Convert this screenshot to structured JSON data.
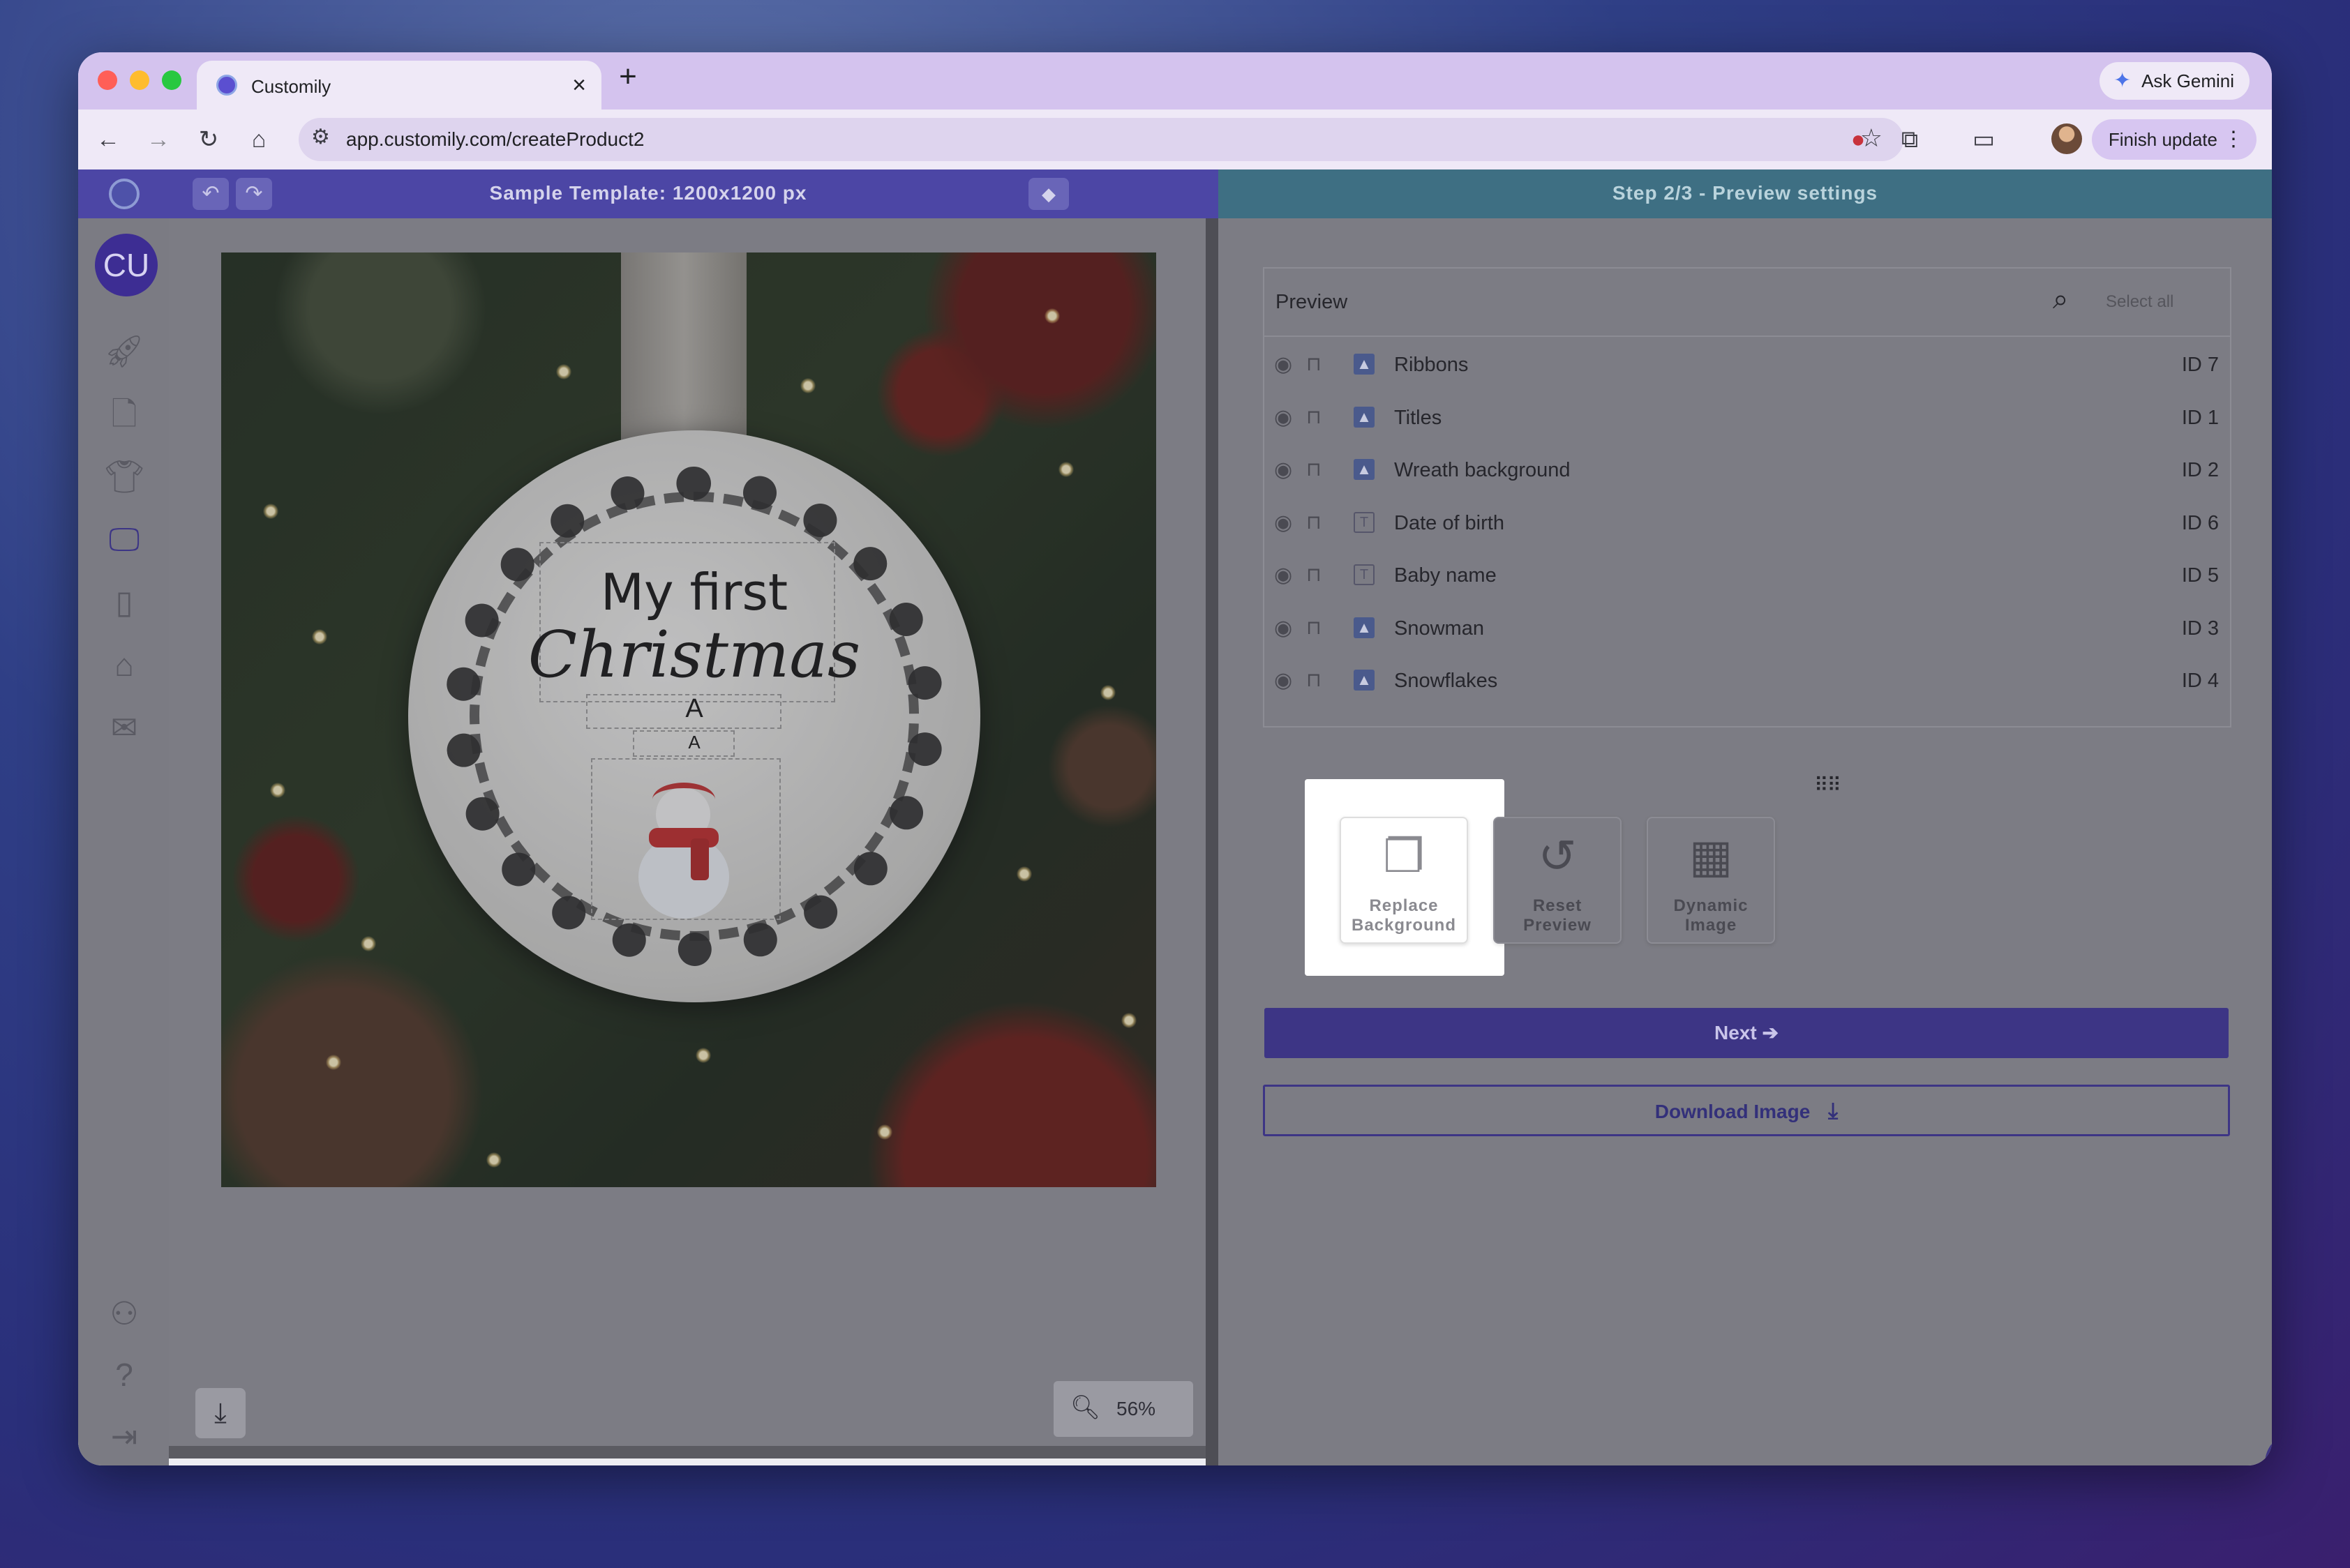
{
  "browser": {
    "tab_title": "Customily",
    "tab_close": "×",
    "new_tab": "+",
    "ask_gemini": "Ask Gemini",
    "url": "app.customily.com/createProduct2",
    "finish_update": "Finish update",
    "traffic_lights": [
      "#ff5f57",
      "#febc2e",
      "#28c840"
    ]
  },
  "app": {
    "template_title": "Sample Template: 1200x1200 px",
    "step_title": "Step 2/3 - Preview settings",
    "avatar_initials": "CU",
    "sidebar_icons": [
      "rocket-icon",
      "file-icon",
      "tshirt-icon",
      "display-icon",
      "book-icon",
      "store-icon",
      "inbox-icon",
      "user-settings-icon",
      "help-icon",
      "logout-icon"
    ],
    "accent": "#3d3585"
  },
  "canvas": {
    "ornament_line1": "My first",
    "ornament_line2": "Christmas",
    "ornament_text_a1": "A",
    "ornament_text_a2": "A",
    "zoom": "56%"
  },
  "preview": {
    "header": "Preview",
    "select_all": "Select all",
    "layers": [
      {
        "name": "Ribbons",
        "id": "ID 7",
        "type": "image"
      },
      {
        "name": "Titles",
        "id": "ID 1",
        "type": "image"
      },
      {
        "name": "Wreath background",
        "id": "ID 2",
        "type": "image"
      },
      {
        "name": "Date of birth",
        "id": "ID 6",
        "type": "text"
      },
      {
        "name": "Baby name",
        "id": "ID 5",
        "type": "text"
      },
      {
        "name": "Snowman",
        "id": "ID 3",
        "type": "image"
      },
      {
        "name": "Snowflakes",
        "id": "ID 4",
        "type": "image"
      }
    ],
    "tools": {
      "replace_line1": "Replace",
      "replace_line2": "Background",
      "reset_line1": "Reset",
      "reset_line2": "Preview",
      "dynamic_line1": "Dynamic",
      "dynamic_line2": "Image"
    },
    "next_label": "Next",
    "download_label": "Download Image"
  }
}
